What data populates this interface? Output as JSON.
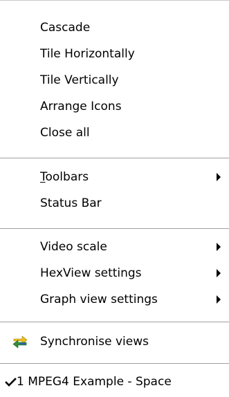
{
  "menu": {
    "items": {
      "cascade": "Cascade",
      "tile_horizontally": "Tile Horizontally",
      "tile_vertically": "Tile Vertically",
      "arrange_icons": "Arrange Icons",
      "close_all": "Close all",
      "toolbars_mnemonic": "T",
      "toolbars_rest": "oolbars",
      "status_bar": "Status Bar",
      "video_scale": "Video scale",
      "hexview_settings": "HexView settings",
      "graph_view_settings": "Graph view settings",
      "synchronise_views": "Synchronise views",
      "window_1": "1 MPEG4 Example - Space"
    },
    "icons": {
      "sync": "synchronise-arrows-icon",
      "check": "checkmark-icon",
      "submenu": "submenu-arrow-icon"
    },
    "colors": {
      "background": "#ffffff",
      "text": "#000000",
      "separator": "#a0a0a0",
      "sync_yellow": "#e8c020",
      "sync_green": "#2f8f3a",
      "sync_blue": "#2a5fb0"
    }
  }
}
